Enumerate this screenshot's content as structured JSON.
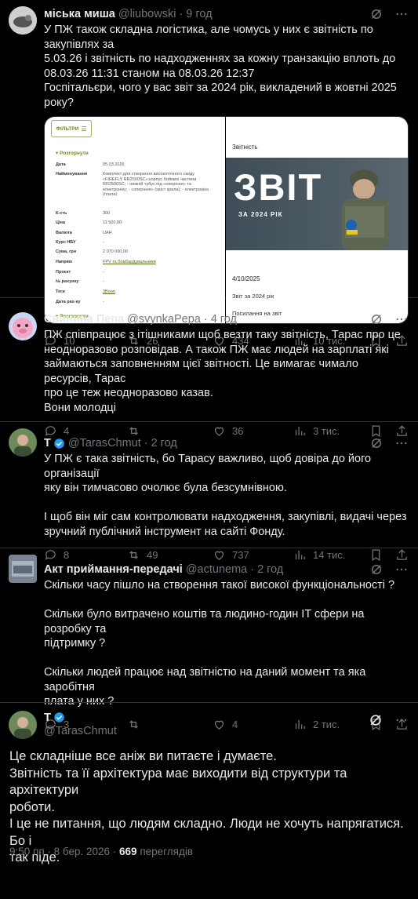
{
  "tweets": [
    {
      "name": "міська миша",
      "handle": "@liubowski",
      "time": "9 год",
      "text": [
        "У ПЖ також складна логістика, але чомусь у них є звітність по закупівлях за",
        "5.03.26 і звітність по надходженнях за кожну транзакцію вплоть до",
        "08.03.26 11:31 станом на 08.03.26 12:37",
        "Госпітальєри, чого у вас звіт за 2024 рік, викладений в жовтні 2025 року?"
      ],
      "replies": "10",
      "reposts": "26",
      "likes": "434",
      "views": "10 тис."
    },
    {
      "name": "Свинина Пепа",
      "handle": "@svynkaPepa",
      "time": "4 год",
      "text": [
        "ПЖ співпрацює з ітішниками щоб везти таку звітність, Тарас про це",
        "неодноразово розповідав. А також ПЖ має людей на зарплаті які",
        "займаються заповненням цієї звітності. Це вимагає чимало ресурсів, Тарас",
        "про це теж неодноразово казав.",
        "Вони молодці"
      ],
      "replies": "4",
      "reposts": "",
      "likes": "36",
      "views": "3 тис."
    },
    {
      "name": "T",
      "handle": "@TarasChmut",
      "time": "2 год",
      "text": [
        "У ПЖ є така звітність, бо Тарасу важливо, щоб довіра до його організації",
        "яку він тимчасово очолює була безсумнівною.",
        "",
        "І щоб він міг сам контролювати надходження, закупівлі, видачі через",
        "зручний публічний інструмент на сайті Фонду."
      ],
      "replies": "8",
      "reposts": "49",
      "likes": "737",
      "views": "14 тис."
    },
    {
      "name": "Акт приймання-передачі",
      "handle": "@actunema",
      "time": "2 год",
      "text": [
        "Скільки часу пішло на створення такої високої функціональності ?",
        "",
        "Скільки було витрачено коштів та людино-годин IT сфери на розробку та",
        "підтримку ?",
        "",
        "Скільки людей працює над звітністю на даний момент та яка заробітня",
        "плата у них ?"
      ],
      "replies": "3",
      "reposts": "",
      "likes": "4",
      "views": "2 тис."
    }
  ],
  "main": {
    "name": "T",
    "handle": "@TarasChmut",
    "text": [
      "Це складніше все аніж ви питаєте і думаєте.",
      "Звітність та її архітектура має виходити від структури та архітектури",
      "роботи.",
      "І це не питання, що людям складно. Люди не хочуть напрягатися. Бо і",
      "так піде."
    ],
    "timestamp": "9:50 пп · 8 бер. 2026 · ",
    "views_count": "669",
    "views_label": " переглядів"
  },
  "media": {
    "filter_label": "ФІЛЬТРИ",
    "section": "Розгорнути",
    "section2": "Розгорнути",
    "rows": [
      {
        "k": "Дата",
        "v": "05.03.2026"
      },
      {
        "k": "Найменування",
        "v": "Комплект для створення високоточного скиду «FIREFLY RR2500SC»:корпус бойової частини RR2500SC; - нижній тубус під «оперіння» та електроніку; - «оперіння» (хвіст крила); - електроніка (плата)"
      },
      {
        "k": "К-сть",
        "v": "300"
      },
      {
        "k": "Ціна",
        "v": "11 500,00"
      },
      {
        "k": "Валюта",
        "v": "UAH"
      },
      {
        "k": "Курс НБУ",
        "v": "-"
      },
      {
        "k": "Сума, грн",
        "v": "2 070 000,00"
      },
      {
        "k": "Напрям",
        "v": "FPV та бомбардувальники"
      },
      {
        "k": "Проєкт",
        "v": "-"
      },
      {
        "k": "№ рахунку",
        "v": "-"
      },
      {
        "k": "Теги",
        "v": "3Вооп"
      },
      {
        "k": "Дата рах-ку",
        "v": "-"
      }
    ],
    "poster_heading": "Звітність",
    "poster_big": "ЗВІТ",
    "poster_sub": "ЗА 2024 РІК",
    "poster_date": "4/10/2025",
    "poster_line1": "Звіт за 2024 рік",
    "poster_line2": "Посилання на звіт",
    "colors": {
      "accent": "#1d9bf0",
      "muted": "#71767b",
      "green": "#6b8e23"
    }
  }
}
